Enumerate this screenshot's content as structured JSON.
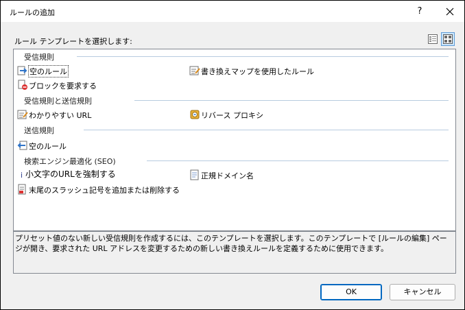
{
  "window": {
    "title": "ルールの追加",
    "help_label": "?"
  },
  "prompt": "ルール テンプレートを選択します:",
  "view_buttons": [
    {
      "name": "list-view-icon",
      "active": false
    },
    {
      "name": "tile-view-icon",
      "active": true
    }
  ],
  "groups": [
    {
      "label": "受信規則",
      "items": [
        {
          "label": "空のルール",
          "icon": "blank-rule-icon",
          "selected": true
        },
        {
          "label": "書き換えマップを使用したルール",
          "icon": "rewrite-map-icon"
        },
        {
          "label": "ブロックを要求する",
          "icon": "block-request-icon"
        }
      ]
    },
    {
      "label": "受信規則と送信規則",
      "items": [
        {
          "label": "わかりやすい URL",
          "icon": "friendly-url-icon"
        },
        {
          "label": "リバース プロキシ",
          "icon": "reverse-proxy-icon"
        }
      ]
    },
    {
      "label": "送信規則",
      "items": [
        {
          "label": "空のルール",
          "icon": "blank-outbound-rule-icon"
        }
      ]
    },
    {
      "label": "検索エンジン最適化 (SEO)",
      "items": [
        {
          "label": "小文字のURLを強制する",
          "icon": "lowercase-url-icon"
        },
        {
          "label": "正規ドメイン名",
          "icon": "canonical-domain-icon"
        },
        {
          "label": "末尾のスラッシュ記号を追加または削除する",
          "icon": "trailing-slash-icon"
        }
      ]
    }
  ],
  "description": "プリセット値のない新しい受信規則を作成するには、このテンプレートを選択します。このテンプレートで [ルールの編集] ページが開き、要求された URL アドレスを変更するための新しい書き換えルールを定義するために使用できます。",
  "buttons": {
    "ok": "OK",
    "cancel": "キャンセル"
  }
}
